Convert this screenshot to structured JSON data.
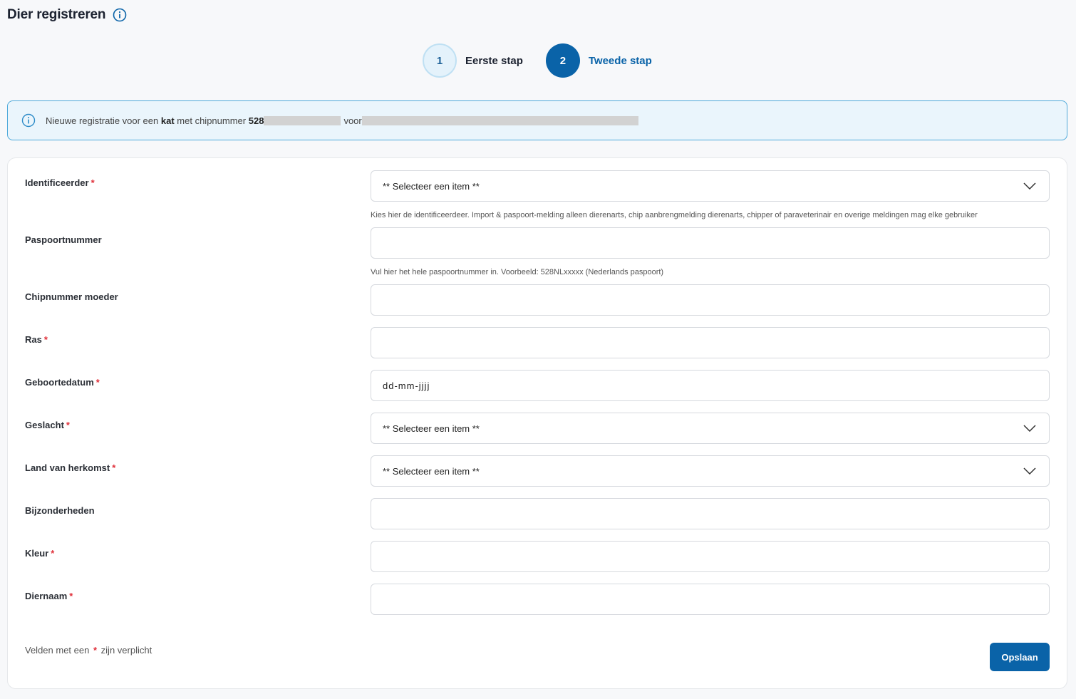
{
  "header": {
    "title": "Dier registreren",
    "info_icon": "info-circle-icon"
  },
  "stepper": {
    "steps": [
      {
        "number": "1",
        "label": "Eerste stap",
        "state": "completed"
      },
      {
        "number": "2",
        "label": "Tweede stap",
        "state": "active"
      }
    ]
  },
  "notice": {
    "icon": "info-circle-icon",
    "text_prefix": "Nieuwe registratie voor een",
    "animal": "kat",
    "text_mid": "met chipnummer",
    "chip_prefix": "528",
    "text_for": "voor"
  },
  "form": {
    "fields": [
      {
        "label": "Identificeerder",
        "required": "*",
        "type": "select",
        "value": "** Selecteer een item **",
        "hint": "Kies hier de identificeerdeer. Import & paspoort-melding alleen dierenarts, chip aanbrengmelding dierenarts, chipper of paraveterinair en overige meldingen mag elke gebruiker"
      },
      {
        "label": "Paspoortnummer",
        "required": "",
        "type": "text",
        "value": "",
        "hint": "Vul hier het hele paspoortnummer in. Voorbeeld: 528NLxxxxx (Nederlands paspoort)"
      },
      {
        "label": "Chipnummer moeder",
        "required": "",
        "type": "text",
        "value": ""
      },
      {
        "label": "Ras",
        "required": "*",
        "type": "text",
        "value": ""
      },
      {
        "label": "Geboortedatum",
        "required": "*",
        "type": "date",
        "value": "dd-mm-jjjj"
      },
      {
        "label": "Geslacht",
        "required": "*",
        "type": "select",
        "value": "** Selecteer een item **"
      },
      {
        "label": "Land van herkomst",
        "required": "*",
        "type": "select",
        "value": "** Selecteer een item **"
      },
      {
        "label": "Bijzonderheden",
        "required": "",
        "type": "text",
        "value": ""
      },
      {
        "label": "Kleur",
        "required": "*",
        "type": "text",
        "value": ""
      },
      {
        "label": "Diernaam",
        "required": "*",
        "type": "text",
        "value": ""
      }
    ],
    "footer_prefix": "Velden met een",
    "footer_star": "*",
    "footer_suffix": "zijn verplicht",
    "save_label": "Opslaan"
  },
  "colors": {
    "primary": "#0a63a8",
    "required": "#e0303a",
    "notice_border": "#4ea9da"
  }
}
